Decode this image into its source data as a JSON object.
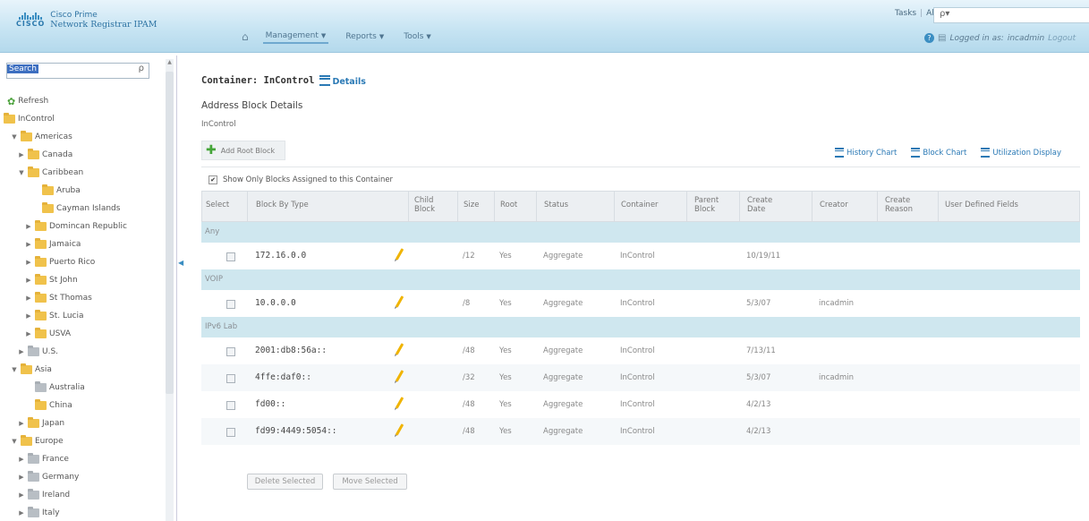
{
  "app": {
    "brand": "Cisco Prime",
    "product": "Network Registrar IPAM",
    "logo_word": "CISCO"
  },
  "nav": {
    "items": [
      {
        "label": "Management",
        "active": true
      },
      {
        "label": "Reports",
        "active": false
      },
      {
        "label": "Tools",
        "active": false
      }
    ]
  },
  "top": {
    "tasks": "Tasks",
    "alerts": "Alerts",
    "search_icon_text": "ρ▾",
    "logged_in_label": "Logged in as:",
    "user": "incadmin",
    "logout": "Logout"
  },
  "sidebar": {
    "search_placeholder": "Search",
    "refresh": "Refresh",
    "tree": [
      {
        "label": "InControl",
        "indent": 0,
        "toggle": "",
        "folder": "yellow"
      },
      {
        "label": "Americas",
        "indent": 1,
        "toggle": "▼",
        "folder": "yellow"
      },
      {
        "label": "Canada",
        "indent": 2,
        "toggle": "▶",
        "folder": "yellow"
      },
      {
        "label": "Caribbean",
        "indent": 2,
        "toggle": "▼",
        "folder": "yellow"
      },
      {
        "label": "Aruba",
        "indent": 4,
        "toggle": "",
        "folder": "yellow"
      },
      {
        "label": "Cayman Islands",
        "indent": 4,
        "toggle": "",
        "folder": "yellow"
      },
      {
        "label": "Domincan Republic",
        "indent": 3,
        "toggle": "▶",
        "folder": "yellow"
      },
      {
        "label": "Jamaica",
        "indent": 3,
        "toggle": "▶",
        "folder": "yellow"
      },
      {
        "label": "Puerto Rico",
        "indent": 3,
        "toggle": "▶",
        "folder": "yellow"
      },
      {
        "label": "St John",
        "indent": 3,
        "toggle": "▶",
        "folder": "yellow"
      },
      {
        "label": "St Thomas",
        "indent": 3,
        "toggle": "▶",
        "folder": "yellow"
      },
      {
        "label": "St. Lucia",
        "indent": 3,
        "toggle": "▶",
        "folder": "yellow"
      },
      {
        "label": "USVA",
        "indent": 3,
        "toggle": "▶",
        "folder": "yellow"
      },
      {
        "label": "U.S.",
        "indent": 2,
        "toggle": "▶",
        "folder": "gray"
      },
      {
        "label": "Asia",
        "indent": 1,
        "toggle": "▼",
        "folder": "yellow"
      },
      {
        "label": "Australia",
        "indent": 3,
        "toggle": "",
        "folder": "gray"
      },
      {
        "label": "China",
        "indent": 3,
        "toggle": "",
        "folder": "yellow"
      },
      {
        "label": "Japan",
        "indent": 2,
        "toggle": "▶",
        "folder": "yellow"
      },
      {
        "label": "Europe",
        "indent": 1,
        "toggle": "▼",
        "folder": "yellow"
      },
      {
        "label": "France",
        "indent": 2,
        "toggle": "▶",
        "folder": "gray"
      },
      {
        "label": "Germany",
        "indent": 2,
        "toggle": "▶",
        "folder": "gray"
      },
      {
        "label": "Ireland",
        "indent": 2,
        "toggle": "▶",
        "folder": "gray"
      },
      {
        "label": "Italy",
        "indent": 2,
        "toggle": "▶",
        "folder": "gray"
      }
    ]
  },
  "main": {
    "container_label": "Container: InControl",
    "details_link": "Details",
    "section_title": "Address Block Details",
    "sub_title": "InControl",
    "add_root_block": "Add Root Block",
    "chart_links": [
      "History Chart",
      "Block Chart",
      "Utilization Display"
    ],
    "show_only_label": "Show Only Blocks Assigned to this Container",
    "show_only_checked": true,
    "columns": [
      "Select",
      "Block By Type",
      "Child\nBlock",
      "Size",
      "Root",
      "Status",
      "Container",
      "Parent\nBlock",
      "Create\nDate",
      "Creator",
      "Create\nReason",
      "User Defined Fields"
    ],
    "groups": [
      {
        "name": "Any",
        "rows": [
          {
            "block": "172.16.0.0",
            "size": "/12",
            "root": "Yes",
            "status": "Aggregate",
            "container": "InControl",
            "date": "10/19/11",
            "creator": ""
          }
        ]
      },
      {
        "name": "VOIP",
        "rows": [
          {
            "block": "10.0.0.0",
            "size": "/8",
            "root": "Yes",
            "status": "Aggregate",
            "container": "InControl",
            "date": "5/3/07",
            "creator": "incadmin"
          }
        ]
      },
      {
        "name": "IPv6 Lab",
        "rows": [
          {
            "block": "2001:db8:56a::",
            "size": "/48",
            "root": "Yes",
            "status": "Aggregate",
            "container": "InControl",
            "date": "7/13/11",
            "creator": ""
          },
          {
            "block": "4ffe:daf0::",
            "size": "/32",
            "root": "Yes",
            "status": "Aggregate",
            "container": "InControl",
            "date": "5/3/07",
            "creator": "incadmin"
          },
          {
            "block": "fd00::",
            "size": "/48",
            "root": "Yes",
            "status": "Aggregate",
            "container": "InControl",
            "date": "4/2/13",
            "creator": ""
          },
          {
            "block": "fd99:4449:5054::",
            "size": "/48",
            "root": "Yes",
            "status": "Aggregate",
            "container": "InControl",
            "date": "4/2/13",
            "creator": ""
          }
        ]
      }
    ],
    "buttons": {
      "delete": "Delete Selected",
      "move": "Move Selected"
    }
  }
}
